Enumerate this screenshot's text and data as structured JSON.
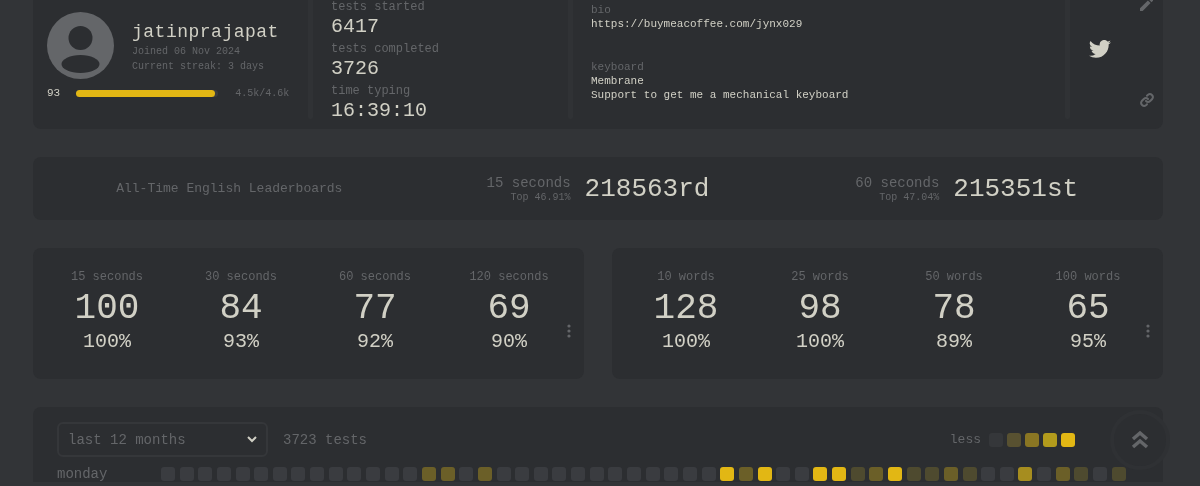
{
  "profile": {
    "name": "jatinprajapat",
    "joined": "Joined 06 Nov 2024",
    "streak": "Current streak: 3 days",
    "xp_level": "93",
    "xp_bar": {
      "level": 0.98
    },
    "xp": "4.5k/4.6k"
  },
  "typing_stats": [
    {
      "label": "tests started",
      "value": "6417"
    },
    {
      "label": "tests completed",
      "value": "3726"
    },
    {
      "label": "time typing",
      "value": "16:39:10"
    }
  ],
  "details": [
    {
      "label": "bio",
      "lines": [
        "https://buymeacoffee.com/jynx029"
      ]
    },
    {
      "label": "keyboard",
      "lines": [
        "Membrane",
        "Support to get me a mechanical keyboard"
      ]
    }
  ],
  "leaderboards": {
    "title": "All-Time English Leaderboards",
    "entries": [
      {
        "label": "15 seconds",
        "top": "Top 46.91%",
        "rank": "218563rd"
      },
      {
        "label": "60 seconds",
        "top": "Top 47.04%",
        "rank": "215351st"
      }
    ]
  },
  "personal_bests": [
    {
      "entries": [
        {
          "label": "15 seconds",
          "wpm": "100",
          "acc": "100%"
        },
        {
          "label": "30 seconds",
          "wpm": "84",
          "acc": "93%"
        },
        {
          "label": "60 seconds",
          "wpm": "77",
          "acc": "92%"
        },
        {
          "label": "120 seconds",
          "wpm": "69",
          "acc": "90%"
        }
      ]
    },
    {
      "entries": [
        {
          "label": "10 words",
          "wpm": "128",
          "acc": "100%"
        },
        {
          "label": "25 words",
          "wpm": "98",
          "acc": "100%"
        },
        {
          "label": "50 words",
          "wpm": "78",
          "acc": "89%"
        },
        {
          "label": "100 words",
          "wpm": "65",
          "acc": "95%"
        }
      ]
    }
  ],
  "activity": {
    "range": "last 12 months",
    "tests": "3723 tests",
    "legend_label": "less",
    "days": [
      {
        "label": "monday",
        "cells": [
          {
            "color": "#3a3c40"
          },
          {
            "color": "#3a3c40"
          },
          {
            "color": "#3a3c40"
          },
          {
            "color": "#3a3c40"
          },
          {
            "color": "#3a3c40"
          },
          {
            "color": "#3a3c40"
          },
          {
            "color": "#3a3c40"
          },
          {
            "color": "#3a3c40"
          },
          {
            "color": "#3a3c40"
          },
          {
            "color": "#3a3c40"
          },
          {
            "color": "#3a3c40"
          },
          {
            "color": "#3a3c40"
          },
          {
            "color": "#3a3c40"
          },
          {
            "color": "#3a3c40"
          },
          {
            "color": "#6b5f28"
          },
          {
            "color": "#6b5f28"
          },
          {
            "color": "#3a3c40"
          },
          {
            "color": "#6b5f28"
          },
          {
            "color": "#3a3c40"
          },
          {
            "color": "#3a3c40"
          },
          {
            "color": "#3a3c40"
          },
          {
            "color": "#3a3c40"
          },
          {
            "color": "#3a3c40"
          },
          {
            "color": "#3a3c40"
          },
          {
            "color": "#3a3c40"
          },
          {
            "color": "#3a3c40"
          },
          {
            "color": "#3a3c40"
          },
          {
            "color": "#3a3c40"
          },
          {
            "color": "#3a3c40"
          },
          {
            "color": "#3a3c40"
          },
          {
            "color": "#e2b714"
          },
          {
            "color": "#6b5f28"
          },
          {
            "color": "#e2b714"
          },
          {
            "color": "#3a3c40"
          },
          {
            "color": "#3a3c40"
          },
          {
            "color": "#e2b714"
          },
          {
            "color": "#e2b714"
          },
          {
            "color": "#4e4a2f"
          },
          {
            "color": "#6b5f28"
          },
          {
            "color": "#e2b714"
          },
          {
            "color": "#4e4a2f"
          },
          {
            "color": "#4e4a2f"
          },
          {
            "color": "#6b5f28"
          },
          {
            "color": "#4e4a2f"
          },
          {
            "color": "#3a3c40"
          },
          {
            "color": "#3a3c40"
          },
          {
            "color": "#a68d1f"
          },
          {
            "color": "#3a3c40"
          },
          {
            "color": "#6b5f28"
          },
          {
            "color": "#4e4a2f"
          },
          {
            "color": "#3a3c40"
          },
          {
            "color": "#4e4a2f"
          }
        ]
      }
    ]
  }
}
